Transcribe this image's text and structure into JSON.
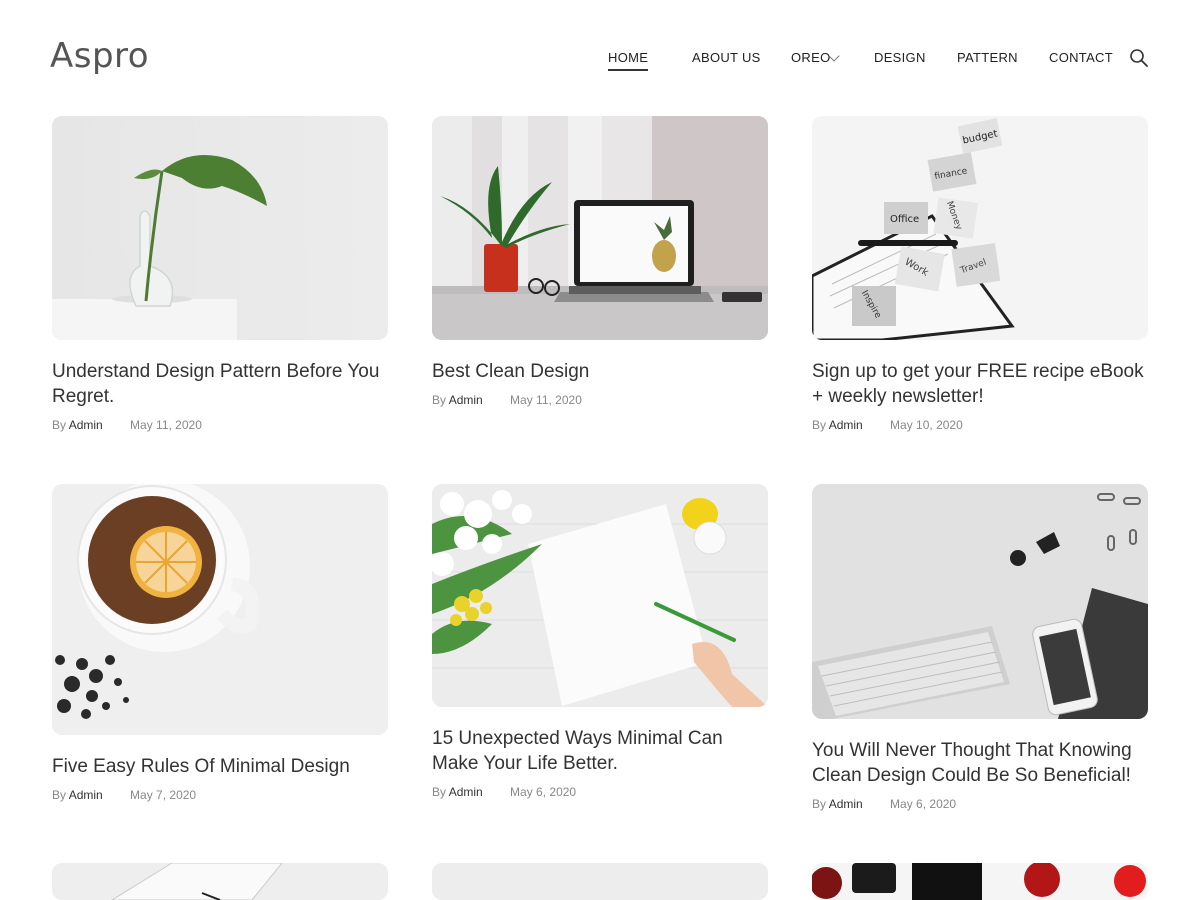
{
  "site": {
    "logo": "Aspro"
  },
  "nav": {
    "items": [
      {
        "label": "HOME"
      },
      {
        "label": "ABOUT US"
      },
      {
        "label": "OREO"
      },
      {
        "label": "DESIGN"
      },
      {
        "label": "PATTERN"
      },
      {
        "label": "CONTACT"
      }
    ],
    "active": "HOME",
    "search_icon": "search-icon",
    "dropdown_icon": "chevron-down-icon"
  },
  "posts": [
    {
      "title": "Understand Design Pattern Before You Regret.",
      "by": "By",
      "author": "Admin",
      "date": "May 11, 2020"
    },
    {
      "title": "Best Clean Design",
      "by": "By",
      "author": "Admin",
      "date": "May 11, 2020"
    },
    {
      "title": "Sign up to get your FREE recipe eBook + weekly newsletter!",
      "by": "By",
      "author": "Admin",
      "date": "May 10, 2020"
    },
    {
      "title": "Five Easy Rules Of Minimal Design",
      "by": "By",
      "author": "Admin",
      "date": "May 7, 2020"
    },
    {
      "title": "15 Unexpected Ways Minimal Can Make Your Life Better.",
      "by": "By",
      "author": "Admin",
      "date": "May 6, 2020"
    },
    {
      "title": "You Will Never Thought That Knowing Clean Design Could Be So Beneficial!",
      "by": "By",
      "author": "Admin",
      "date": "May 6, 2020"
    }
  ],
  "images": {
    "paper_note_labels": [
      "budget",
      "finance",
      "Office",
      "Money",
      "Work",
      "Inspire",
      "Travel"
    ]
  },
  "colors": {
    "text": "#333333",
    "muted": "#888888",
    "logo": "#555555"
  }
}
